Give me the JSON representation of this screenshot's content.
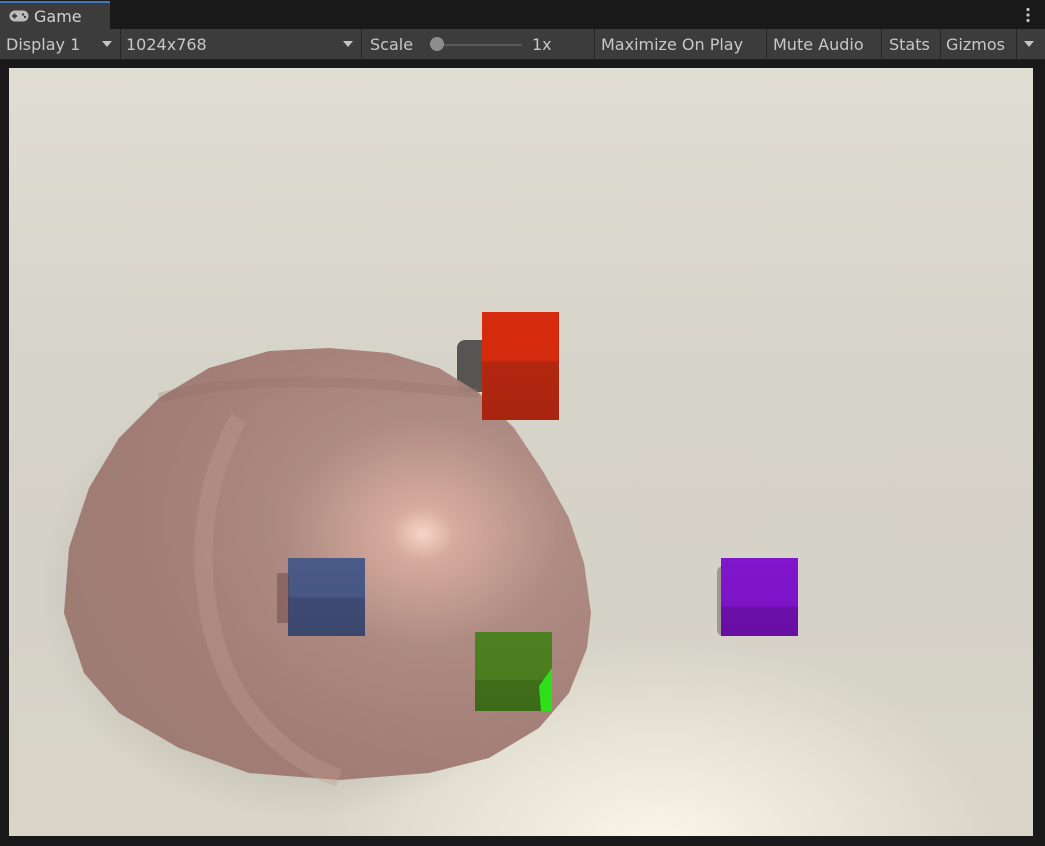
{
  "window": {
    "tab_title": "Game",
    "tab_icon": "gamepad-icon",
    "menu_icon": "kebab-menu-icon"
  },
  "toolbar": {
    "display_label": "Display 1",
    "resolution_label": "1024x768",
    "scale_label": "Scale",
    "scale_value": "1x",
    "scale_slider_fraction": 0,
    "maximize_label": "Maximize On Play",
    "mute_label": "Mute Audio",
    "stats_label": "Stats",
    "gizmos_label": "Gizmos"
  },
  "scene": {
    "background_color": "#d8d5cb",
    "objects": [
      {
        "name": "dome",
        "color": "#a97e76"
      },
      {
        "name": "red-cube",
        "color": "#d42a10"
      },
      {
        "name": "blue-cube",
        "color": "#46557f"
      },
      {
        "name": "green-cube",
        "color": "#4a7c1c"
      },
      {
        "name": "purple-cube",
        "color": "#7c12c4"
      }
    ]
  }
}
